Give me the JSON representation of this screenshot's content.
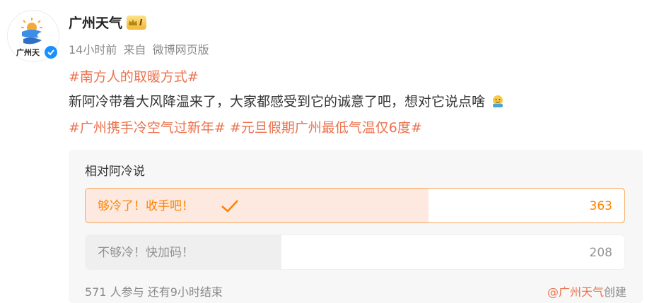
{
  "author": {
    "name": "广州天气",
    "avatar_text": "广州天",
    "level_badge": "I"
  },
  "meta": {
    "time": "14小时前",
    "from_label": "来自",
    "source": "微博网页版"
  },
  "post": {
    "topic1": "#南方人的取暖方式#",
    "text": "新阿冷带着大风降温来了，大家都感受到它的诚意了吧，想对它说点啥",
    "emoji": "emoji-face-icon",
    "topic2": "#广州携手冷空气过新年#",
    "topic3": "#元旦假期广州最低气温仅6度#"
  },
  "poll": {
    "title": "相对阿冷说",
    "options": [
      {
        "label": "够冷了！收手吧！",
        "count": "363",
        "fraction": 0.636,
        "selected": true
      },
      {
        "label": "不够冷！快加码！",
        "count": "208",
        "fraction": 0.364,
        "selected": false
      }
    ],
    "participants": "571 人参与",
    "remaining": "还有9小时结束",
    "creator_prefix": "@广州天气",
    "creator_suffix": "创建"
  },
  "colors": {
    "topic": "#eb7350",
    "selected_option": "#ff8200",
    "verify_blue": "#1890ff"
  }
}
